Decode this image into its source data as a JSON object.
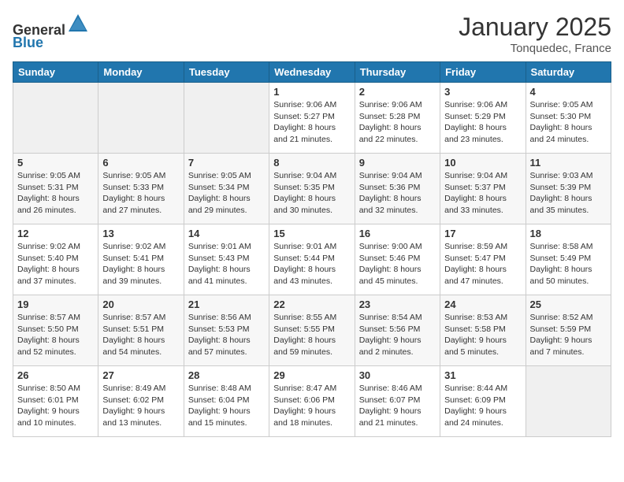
{
  "header": {
    "logo_general": "General",
    "logo_blue": "Blue",
    "month": "January 2025",
    "location": "Tonquedec, France"
  },
  "weekdays": [
    "Sunday",
    "Monday",
    "Tuesday",
    "Wednesday",
    "Thursday",
    "Friday",
    "Saturday"
  ],
  "weeks": [
    [
      {
        "day": "",
        "info": ""
      },
      {
        "day": "",
        "info": ""
      },
      {
        "day": "",
        "info": ""
      },
      {
        "day": "1",
        "info": "Sunrise: 9:06 AM\nSunset: 5:27 PM\nDaylight: 8 hours and 21 minutes."
      },
      {
        "day": "2",
        "info": "Sunrise: 9:06 AM\nSunset: 5:28 PM\nDaylight: 8 hours and 22 minutes."
      },
      {
        "day": "3",
        "info": "Sunrise: 9:06 AM\nSunset: 5:29 PM\nDaylight: 8 hours and 23 minutes."
      },
      {
        "day": "4",
        "info": "Sunrise: 9:05 AM\nSunset: 5:30 PM\nDaylight: 8 hours and 24 minutes."
      }
    ],
    [
      {
        "day": "5",
        "info": "Sunrise: 9:05 AM\nSunset: 5:31 PM\nDaylight: 8 hours and 26 minutes."
      },
      {
        "day": "6",
        "info": "Sunrise: 9:05 AM\nSunset: 5:33 PM\nDaylight: 8 hours and 27 minutes."
      },
      {
        "day": "7",
        "info": "Sunrise: 9:05 AM\nSunset: 5:34 PM\nDaylight: 8 hours and 29 minutes."
      },
      {
        "day": "8",
        "info": "Sunrise: 9:04 AM\nSunset: 5:35 PM\nDaylight: 8 hours and 30 minutes."
      },
      {
        "day": "9",
        "info": "Sunrise: 9:04 AM\nSunset: 5:36 PM\nDaylight: 8 hours and 32 minutes."
      },
      {
        "day": "10",
        "info": "Sunrise: 9:04 AM\nSunset: 5:37 PM\nDaylight: 8 hours and 33 minutes."
      },
      {
        "day": "11",
        "info": "Sunrise: 9:03 AM\nSunset: 5:39 PM\nDaylight: 8 hours and 35 minutes."
      }
    ],
    [
      {
        "day": "12",
        "info": "Sunrise: 9:02 AM\nSunset: 5:40 PM\nDaylight: 8 hours and 37 minutes."
      },
      {
        "day": "13",
        "info": "Sunrise: 9:02 AM\nSunset: 5:41 PM\nDaylight: 8 hours and 39 minutes."
      },
      {
        "day": "14",
        "info": "Sunrise: 9:01 AM\nSunset: 5:43 PM\nDaylight: 8 hours and 41 minutes."
      },
      {
        "day": "15",
        "info": "Sunrise: 9:01 AM\nSunset: 5:44 PM\nDaylight: 8 hours and 43 minutes."
      },
      {
        "day": "16",
        "info": "Sunrise: 9:00 AM\nSunset: 5:46 PM\nDaylight: 8 hours and 45 minutes."
      },
      {
        "day": "17",
        "info": "Sunrise: 8:59 AM\nSunset: 5:47 PM\nDaylight: 8 hours and 47 minutes."
      },
      {
        "day": "18",
        "info": "Sunrise: 8:58 AM\nSunset: 5:49 PM\nDaylight: 8 hours and 50 minutes."
      }
    ],
    [
      {
        "day": "19",
        "info": "Sunrise: 8:57 AM\nSunset: 5:50 PM\nDaylight: 8 hours and 52 minutes."
      },
      {
        "day": "20",
        "info": "Sunrise: 8:57 AM\nSunset: 5:51 PM\nDaylight: 8 hours and 54 minutes."
      },
      {
        "day": "21",
        "info": "Sunrise: 8:56 AM\nSunset: 5:53 PM\nDaylight: 8 hours and 57 minutes."
      },
      {
        "day": "22",
        "info": "Sunrise: 8:55 AM\nSunset: 5:55 PM\nDaylight: 8 hours and 59 minutes."
      },
      {
        "day": "23",
        "info": "Sunrise: 8:54 AM\nSunset: 5:56 PM\nDaylight: 9 hours and 2 minutes."
      },
      {
        "day": "24",
        "info": "Sunrise: 8:53 AM\nSunset: 5:58 PM\nDaylight: 9 hours and 5 minutes."
      },
      {
        "day": "25",
        "info": "Sunrise: 8:52 AM\nSunset: 5:59 PM\nDaylight: 9 hours and 7 minutes."
      }
    ],
    [
      {
        "day": "26",
        "info": "Sunrise: 8:50 AM\nSunset: 6:01 PM\nDaylight: 9 hours and 10 minutes."
      },
      {
        "day": "27",
        "info": "Sunrise: 8:49 AM\nSunset: 6:02 PM\nDaylight: 9 hours and 13 minutes."
      },
      {
        "day": "28",
        "info": "Sunrise: 8:48 AM\nSunset: 6:04 PM\nDaylight: 9 hours and 15 minutes."
      },
      {
        "day": "29",
        "info": "Sunrise: 8:47 AM\nSunset: 6:06 PM\nDaylight: 9 hours and 18 minutes."
      },
      {
        "day": "30",
        "info": "Sunrise: 8:46 AM\nSunset: 6:07 PM\nDaylight: 9 hours and 21 minutes."
      },
      {
        "day": "31",
        "info": "Sunrise: 8:44 AM\nSunset: 6:09 PM\nDaylight: 9 hours and 24 minutes."
      },
      {
        "day": "",
        "info": ""
      }
    ]
  ]
}
